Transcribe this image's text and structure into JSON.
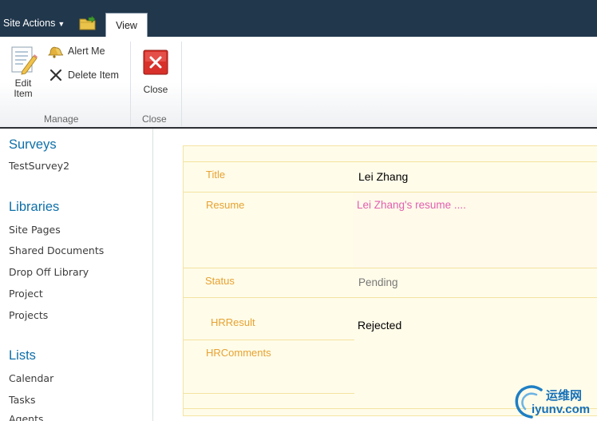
{
  "topbar": {
    "site_actions_label": "Site Actions",
    "tab_view_label": "View"
  },
  "ribbon": {
    "edit_item_line1": "Edit",
    "edit_item_line2": "Item",
    "alert_me_label": "Alert Me",
    "delete_item_label": "Delete Item",
    "close_label": "Close",
    "group_manage": "Manage",
    "group_close": "Close"
  },
  "leftnav": {
    "surveys_heading": "Surveys",
    "surveys_items": [
      "TestSurvey2"
    ],
    "libraries_heading": "Libraries",
    "libraries_items": [
      "Site Pages",
      "Shared Documents",
      "Drop Off Library",
      "Project",
      "Projects"
    ],
    "lists_heading": "Lists",
    "lists_items": [
      "Calendar",
      "Tasks",
      "Agents"
    ]
  },
  "form": {
    "fields": [
      {
        "label": "Title",
        "value": "Lei Zhang"
      },
      {
        "label": "Resume",
        "value": "Lei Zhang's resume ...."
      },
      {
        "label": "Status",
        "value": "Pending"
      },
      {
        "label": "HRResult",
        "value": "Rejected"
      },
      {
        "label": "HRComments",
        "value": ""
      }
    ]
  },
  "watermark": {
    "text_cn": "运维网",
    "text_url": "iyunv.com"
  },
  "colors": {
    "topbar": "#21374c",
    "nav_heading": "#0e6fa8",
    "field_label": "#e6a232",
    "form_bg": "#fffce9",
    "resume_link": "#e060b0"
  }
}
